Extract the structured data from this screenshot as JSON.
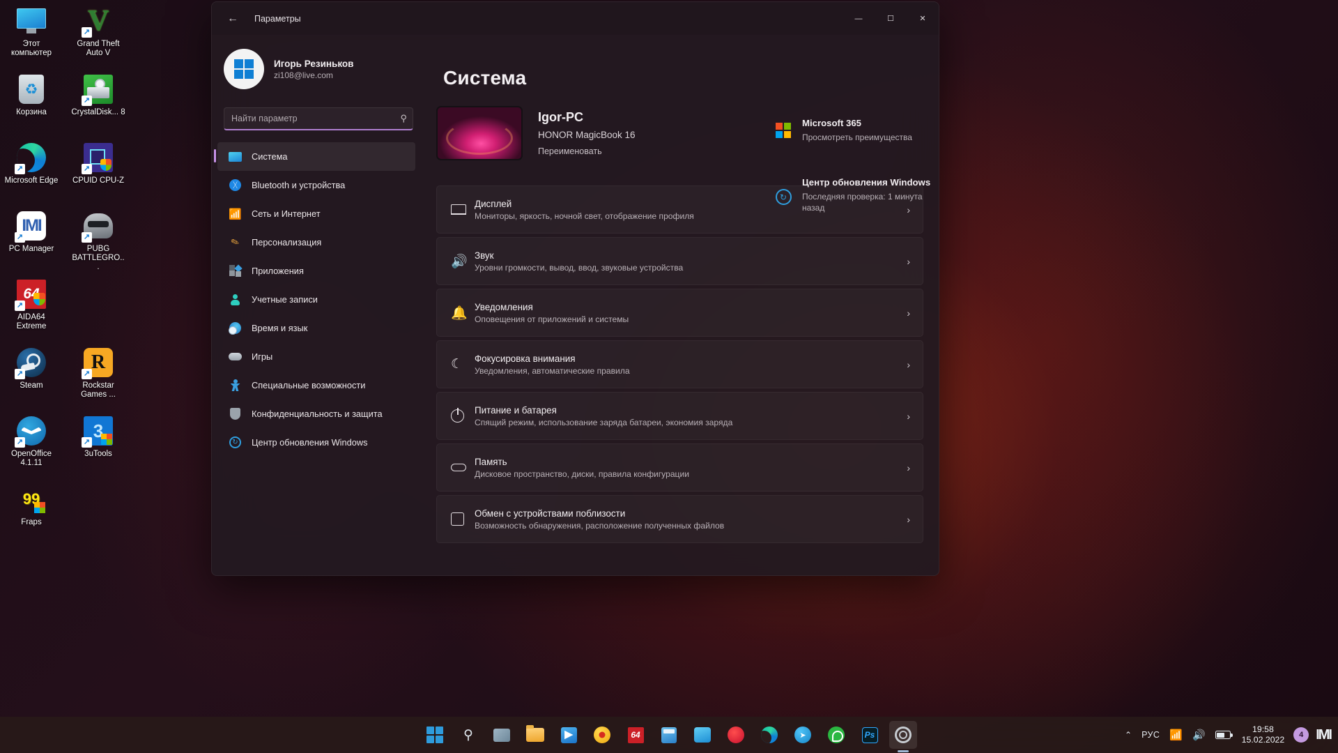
{
  "desktop": {
    "icons": [
      {
        "label": "Этот компьютер",
        "icon": "this-pc-icon",
        "shortcut": false
      },
      {
        "label": "Grand Theft Auto V",
        "icon": "gta-v-icon",
        "shortcut": true
      },
      {
        "label": "Корзина",
        "icon": "recycle-bin-icon",
        "shortcut": false
      },
      {
        "label": "CrystalDisk... 8",
        "icon": "crystaldiskinfo-icon",
        "shortcut": true
      },
      {
        "label": "Microsoft Edge",
        "icon": "microsoft-edge-icon",
        "shortcut": true
      },
      {
        "label": "CPUID CPU-Z",
        "icon": "cpuid-cpuz-icon",
        "shortcut": true
      },
      {
        "label": "PC Manager",
        "icon": "pc-manager-icon",
        "shortcut": true
      },
      {
        "label": "PUBG BATTLEGRO...",
        "icon": "pubg-icon",
        "shortcut": true
      },
      {
        "label": "AIDA64 Extreme",
        "icon": "aida64-icon",
        "shortcut": true
      },
      {
        "label": "",
        "icon": "empty-icon",
        "shortcut": false
      },
      {
        "label": "Steam",
        "icon": "steam-icon",
        "shortcut": true
      },
      {
        "label": "Rockstar Games ...",
        "icon": "rockstar-games-icon",
        "shortcut": true
      },
      {
        "label": "OpenOffice 4.1.11",
        "icon": "openoffice-icon",
        "shortcut": true
      },
      {
        "label": "3uTools",
        "icon": "3utools-icon",
        "shortcut": true
      },
      {
        "label": "Fraps",
        "icon": "fraps-icon",
        "shortcut": false
      }
    ]
  },
  "window": {
    "title": "Параметры",
    "back_label": "←",
    "controls": {
      "minimize": "—",
      "maximize": "☐",
      "close": "✕"
    }
  },
  "sidebar": {
    "account": {
      "name": "Игорь Резиньков",
      "email": "zi108@live.com",
      "avatar_icon": "windows-logo-avatar"
    },
    "search": {
      "placeholder": "Найти параметр",
      "value": "",
      "icon": "search-icon"
    },
    "items": [
      {
        "label": "Система",
        "icon": "system-icon",
        "active": true
      },
      {
        "label": "Bluetooth и устройства",
        "icon": "bluetooth-icon",
        "active": false
      },
      {
        "label": "Сеть и Интернет",
        "icon": "network-icon",
        "active": false
      },
      {
        "label": "Персонализация",
        "icon": "personalization-icon",
        "active": false
      },
      {
        "label": "Приложения",
        "icon": "apps-icon",
        "active": false
      },
      {
        "label": "Учетные записи",
        "icon": "accounts-icon",
        "active": false
      },
      {
        "label": "Время и язык",
        "icon": "time-language-icon",
        "active": false
      },
      {
        "label": "Игры",
        "icon": "gaming-icon",
        "active": false
      },
      {
        "label": "Специальные возможности",
        "icon": "accessibility-icon",
        "active": false
      },
      {
        "label": "Конфиденциальность и защита",
        "icon": "privacy-icon",
        "active": false
      },
      {
        "label": "Центр обновления Windows",
        "icon": "windows-update-icon",
        "active": false
      }
    ]
  },
  "main": {
    "page_title": "Система",
    "device": {
      "name": "Igor-PC",
      "model": "HONOR MagicBook 16",
      "rename_label": "Переименовать",
      "thumb_icon": "device-thumbnail"
    },
    "side_cards": [
      {
        "title": "Microsoft 365",
        "subtitle": "Просмотреть преимущества",
        "icon": "microsoft-365-icon"
      },
      {
        "title": "Центр обновления Windows",
        "subtitle": "Последняя проверка: 1 минута назад",
        "icon": "windows-update-icon"
      }
    ],
    "settings_rows": [
      {
        "title": "Дисплей",
        "subtitle": "Мониторы, яркость, ночной свет, отображение профиля",
        "icon": "display-icon",
        "chevron": "›"
      },
      {
        "title": "Звук",
        "subtitle": "Уровни громкости, вывод, ввод, звуковые устройства",
        "icon": "sound-icon",
        "chevron": "›"
      },
      {
        "title": "Уведомления",
        "subtitle": "Оповещения от приложений и системы",
        "icon": "notifications-icon",
        "chevron": "›"
      },
      {
        "title": "Фокусировка внимания",
        "subtitle": "Уведомления, автоматические правила",
        "icon": "focus-assist-icon",
        "chevron": "›"
      },
      {
        "title": "Питание и батарея",
        "subtitle": "Спящий режим, использование заряда батареи, экономия заряда",
        "icon": "power-battery-icon",
        "chevron": "›"
      },
      {
        "title": "Память",
        "subtitle": "Дисковое пространство, диски, правила конфигурации",
        "icon": "storage-icon",
        "chevron": "›"
      },
      {
        "title": "Обмен с устройствами поблизости",
        "subtitle": "Возможность обнаружения, расположение полученных файлов",
        "icon": "nearby-sharing-icon",
        "chevron": "›"
      }
    ]
  },
  "taskbar": {
    "buttons": [
      {
        "name": "start-button",
        "icon": "windows-start-icon",
        "active": false
      },
      {
        "name": "search-button",
        "icon": "search-icon",
        "active": false
      },
      {
        "name": "widgets-button",
        "icon": "widgets-icon",
        "active": false
      },
      {
        "name": "file-explorer-button",
        "icon": "file-explorer-icon",
        "active": false
      },
      {
        "name": "microsoft-store-button",
        "icon": "microsoft-store-icon",
        "active": false
      },
      {
        "name": "yandex-browser-button",
        "icon": "yandex-browser-icon",
        "active": false
      },
      {
        "name": "aida64-button",
        "icon": "aida64-icon",
        "active": false
      },
      {
        "name": "calculator-button",
        "icon": "calculator-icon",
        "active": false
      },
      {
        "name": "teams-button",
        "icon": "teams-icon",
        "active": false
      },
      {
        "name": "opera-button",
        "icon": "opera-icon",
        "active": false
      },
      {
        "name": "edge-button",
        "icon": "microsoft-edge-icon",
        "active": false
      },
      {
        "name": "telegram-button",
        "icon": "telegram-icon",
        "active": false
      },
      {
        "name": "whatsapp-button",
        "icon": "whatsapp-icon",
        "active": false
      },
      {
        "name": "photoshop-button",
        "icon": "photoshop-icon",
        "active": false
      },
      {
        "name": "settings-button",
        "icon": "settings-gear-icon",
        "active": true
      }
    ],
    "tray": {
      "chevron": "⌃",
      "language": "РУС",
      "wifi_icon": "wifi-icon",
      "volume_icon": "volume-icon",
      "battery_icon": "battery-icon",
      "time": "19:58",
      "date": "15.02.2022",
      "notification_count": "4",
      "pc_manager_icon": "pc-manager-tray-icon"
    }
  },
  "colors": {
    "accent": "#c792e8",
    "window_bg": "#231920",
    "taskbar_bg": "#281a18",
    "text_primary": "#f3eff2",
    "text_secondary": "#b9b1b7"
  }
}
